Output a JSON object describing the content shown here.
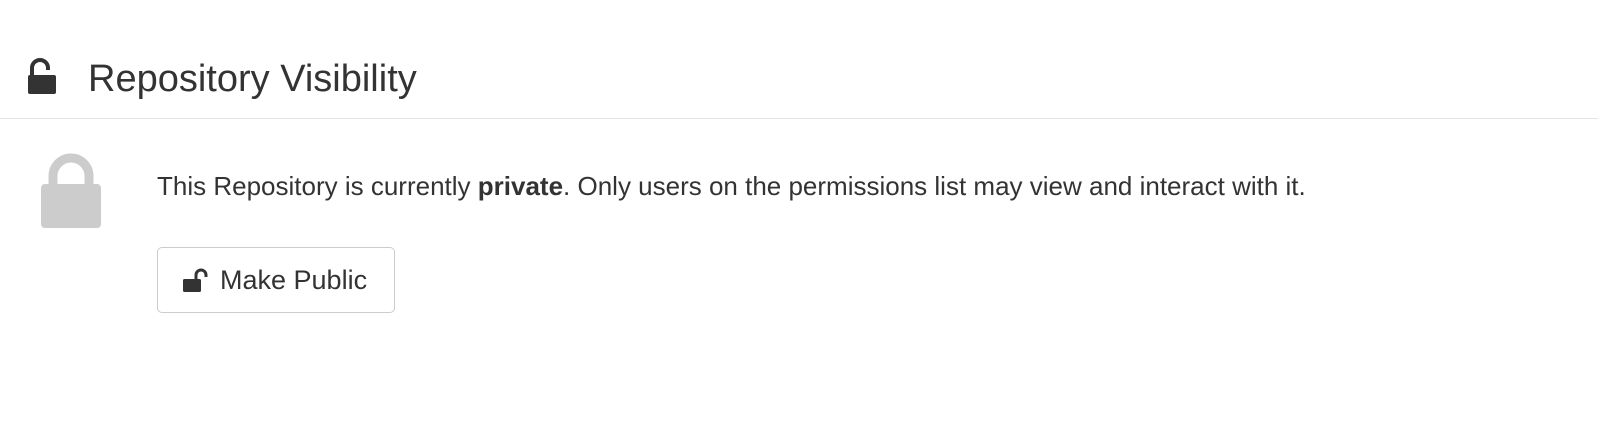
{
  "header": {
    "icon": "unlock-icon",
    "title": "Repository Visibility"
  },
  "visibility": {
    "icon": "lock-icon",
    "status_prefix": "This Repository is currently ",
    "status_value": "private",
    "status_suffix": ". Only users on the permissions list may view and interact with it.",
    "action": {
      "icon": "unlock-icon",
      "label": "Make Public"
    }
  },
  "colors": {
    "text": "#333333",
    "lock_gray": "#cccccc",
    "divider": "#e5e5e5",
    "button_border": "#cccccc"
  }
}
